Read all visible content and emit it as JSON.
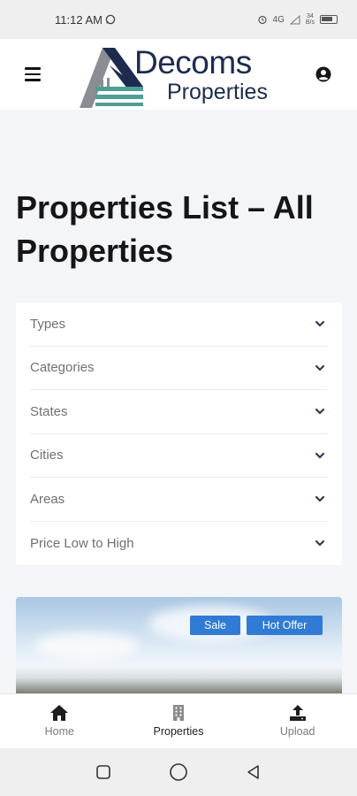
{
  "status_bar": {
    "time": "11:12 AM",
    "network": "4G",
    "speed": "34\nB/s"
  },
  "header": {
    "brand_name": "Decoms",
    "brand_sub": "Properties"
  },
  "page": {
    "title": "Properties List – All Properties"
  },
  "filters": [
    {
      "label": "Types"
    },
    {
      "label": "Categories"
    },
    {
      "label": "States"
    },
    {
      "label": "Cities"
    },
    {
      "label": "Areas"
    },
    {
      "label": "Price Low to High"
    }
  ],
  "property_card": {
    "badges": [
      "Sale",
      "Hot Offer"
    ]
  },
  "bottom_nav": [
    {
      "label": "Home",
      "icon": "home-icon"
    },
    {
      "label": "Properties",
      "icon": "building-icon"
    },
    {
      "label": "Upload",
      "icon": "upload-icon"
    }
  ],
  "colors": {
    "brand_navy": "#1d2b4f",
    "badge_blue": "#2f7bd6",
    "logo_teal": "#4f9e96"
  }
}
